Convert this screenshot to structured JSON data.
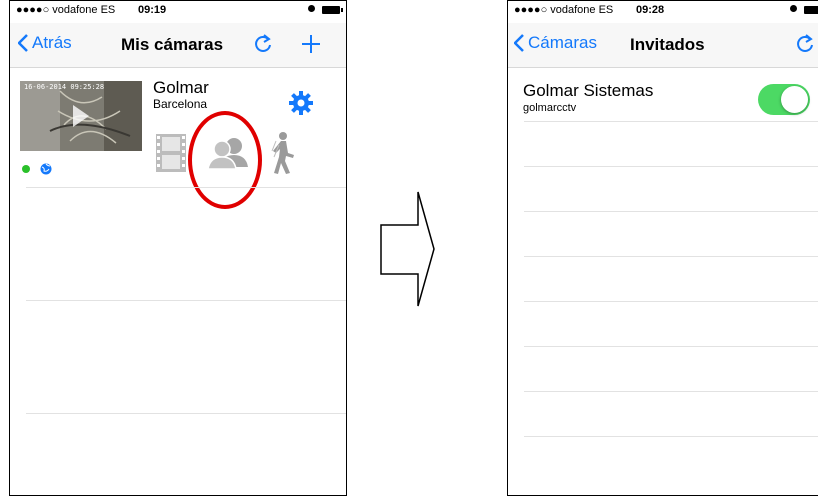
{
  "left_screen": {
    "status": {
      "carrier": "●●●●○ vodafone ES",
      "time": "09:19"
    },
    "nav": {
      "back_label": "Atrás",
      "title": "Mis cámaras"
    },
    "camera": {
      "thumbnail_stamp": "16-06-2014 09:25:28",
      "name": "Golmar",
      "city": "Barcelona",
      "online_color": "#2ac02a"
    }
  },
  "right_screen": {
    "status": {
      "carrier": "●●●●○ vodafone ES",
      "time": "09:28"
    },
    "nav": {
      "back_label": "Cámaras",
      "title": "Invitados"
    },
    "guest": {
      "name": "Golmar Sistemas",
      "user": "golmarcctv",
      "enabled": true
    }
  },
  "colors": {
    "ios_blue": "#1479fb",
    "annotation_red": "#e00000",
    "toggle_green": "#4cd964"
  },
  "icons": [
    "refresh-icon",
    "add-icon",
    "gear-icon",
    "film-icon",
    "users-icon",
    "walking-person-icon",
    "globe-icon",
    "play-icon",
    "right-arrow-icon"
  ]
}
